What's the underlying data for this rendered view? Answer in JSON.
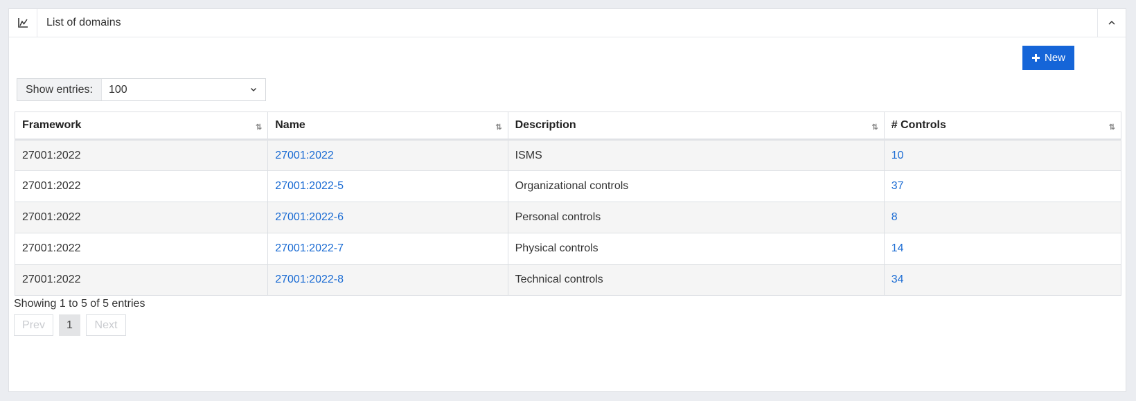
{
  "panel": {
    "title": "List of domains",
    "icon": "chart-line-icon",
    "collapse_icon": "chevron-up-icon"
  },
  "toolbar": {
    "new_label": "New",
    "new_icon": "plus-icon",
    "accent": "#1565d8"
  },
  "entries": {
    "label": "Show entries:",
    "value": "100"
  },
  "table": {
    "headers": [
      "Framework",
      "Name",
      "Description",
      "# Controls"
    ],
    "rows": [
      {
        "framework": "27001:2022",
        "name": "27001:2022",
        "description": "ISMS",
        "controls": "10"
      },
      {
        "framework": "27001:2022",
        "name": "27001:2022-5",
        "description": "Organizational controls",
        "controls": "37"
      },
      {
        "framework": "27001:2022",
        "name": "27001:2022-6",
        "description": "Personal controls",
        "controls": "8"
      },
      {
        "framework": "27001:2022",
        "name": "27001:2022-7",
        "description": "Physical controls",
        "controls": "14"
      },
      {
        "framework": "27001:2022",
        "name": "27001:2022-8",
        "description": "Technical controls",
        "controls": "34"
      }
    ]
  },
  "footer": {
    "info": "Showing 1 to 5 of 5 entries",
    "prev": "Prev",
    "page": "1",
    "next": "Next"
  }
}
